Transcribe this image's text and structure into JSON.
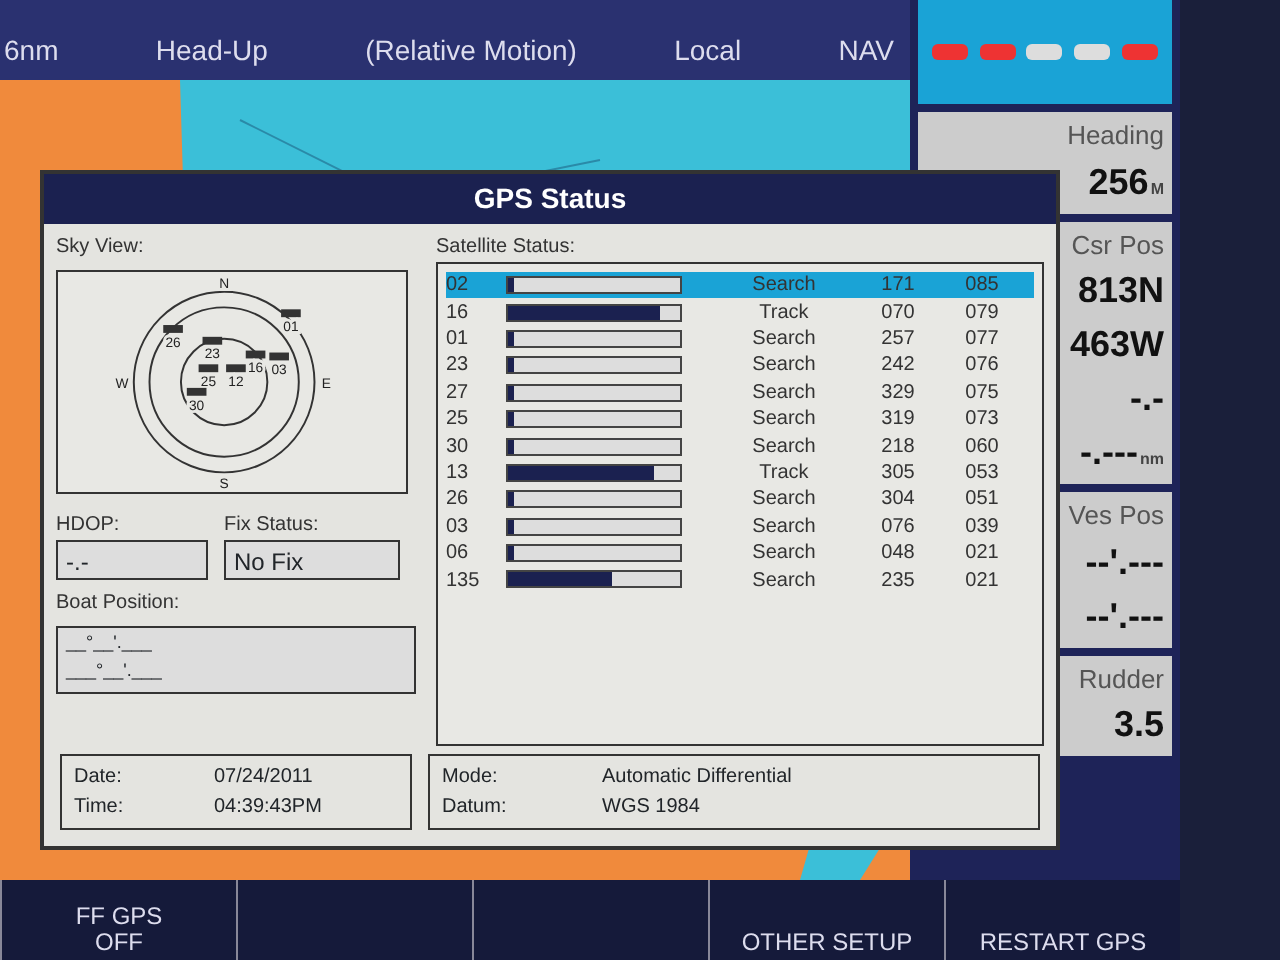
{
  "top_bar": {
    "items": [
      "6nm",
      "Head-Up",
      "(Relative Motion)",
      "Local",
      "NAV"
    ]
  },
  "dialog": {
    "title": "GPS Status",
    "sky_view": {
      "label": "Sky View:",
      "compass": [
        "N",
        "E",
        "S",
        "W"
      ],
      "satellites": [
        "01",
        "03",
        "26",
        "23",
        "25",
        "12",
        "16",
        "30"
      ]
    },
    "hdop": {
      "label": "HDOP:",
      "value": "-.-"
    },
    "fix_status": {
      "label": "Fix Status:",
      "value": "No Fix"
    },
    "boat_position": {
      "label": "Boat Position:",
      "lines": [
        "__°__'.___",
        "___°__'.___"
      ]
    },
    "satellite_status": {
      "label": "Satellite Status:",
      "rows": [
        {
          "prn": "02",
          "level": 0.02,
          "status": "Search",
          "azimuth": "171",
          "elevation": "085",
          "selected": true
        },
        {
          "prn": "16",
          "level": 0.88,
          "status": "Track",
          "azimuth": "070",
          "elevation": "079",
          "selected": false
        },
        {
          "prn": "01",
          "level": 0.02,
          "status": "Search",
          "azimuth": "257",
          "elevation": "077",
          "selected": false
        },
        {
          "prn": "23",
          "level": 0.02,
          "status": "Search",
          "azimuth": "242",
          "elevation": "076",
          "selected": false
        },
        {
          "prn": "27",
          "level": 0.02,
          "status": "Search",
          "azimuth": "329",
          "elevation": "075",
          "selected": false
        },
        {
          "prn": "25",
          "level": 0.02,
          "status": "Search",
          "azimuth": "319",
          "elevation": "073",
          "selected": false
        },
        {
          "prn": "30",
          "level": 0.02,
          "status": "Search",
          "azimuth": "218",
          "elevation": "060",
          "selected": false
        },
        {
          "prn": "13",
          "level": 0.85,
          "status": "Track",
          "azimuth": "305",
          "elevation": "053",
          "selected": false
        },
        {
          "prn": "26",
          "level": 0.02,
          "status": "Search",
          "azimuth": "304",
          "elevation": "051",
          "selected": false
        },
        {
          "prn": "03",
          "level": 0.02,
          "status": "Search",
          "azimuth": "076",
          "elevation": "039",
          "selected": false
        },
        {
          "prn": "06",
          "level": 0.02,
          "status": "Search",
          "azimuth": "048",
          "elevation": "021",
          "selected": false
        },
        {
          "prn": "135",
          "level": 0.6,
          "status": "Search",
          "azimuth": "235",
          "elevation": "021",
          "selected": false
        }
      ]
    },
    "date_time": [
      {
        "label": "Date:",
        "value": "07/24/2011"
      },
      {
        "label": "Time:",
        "value": "04:39:43PM"
      }
    ],
    "mode_datum": [
      {
        "label": "Mode:",
        "value": "Automatic Differential"
      },
      {
        "label": "Datum:",
        "value": "WGS 1984"
      }
    ]
  },
  "side_panel": {
    "boxes": [
      {
        "label": "Heading",
        "lines": [
          {
            "value": "256",
            "unit": "M"
          }
        ]
      },
      {
        "label": "Csr Pos",
        "lines": [
          {
            "value": "813N"
          },
          {
            "value": "463W"
          },
          {
            "value": "-.-"
          },
          {
            "value": "-.---",
            "unit": "nm"
          }
        ]
      },
      {
        "label": "Ves Pos",
        "lines": [
          {
            "value": "--'.---"
          },
          {
            "value": "--'.---"
          }
        ]
      },
      {
        "label": "Rudder",
        "lines": [
          {
            "value": "3.5"
          }
        ]
      }
    ]
  },
  "softkeys": [
    {
      "kind": "label",
      "lines": [
        "FF GPS",
        "OFF"
      ]
    },
    {
      "kind": "blank"
    },
    {
      "kind": "blank"
    },
    {
      "kind": "label",
      "lines": [
        "OTHER SETUP"
      ]
    },
    {
      "kind": "label",
      "lines": [
        "RESTART GPS"
      ]
    }
  ]
}
